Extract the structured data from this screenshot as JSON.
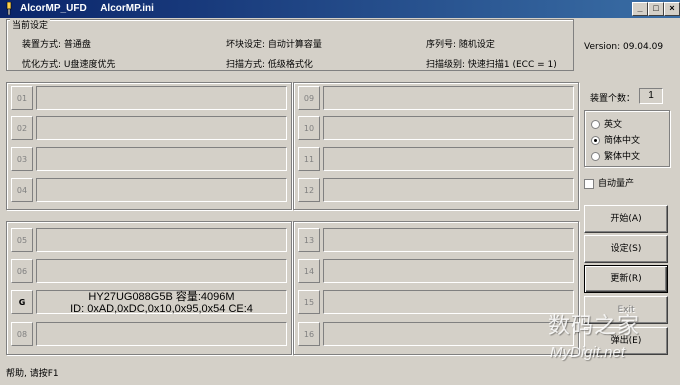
{
  "window": {
    "title": "AlcorMP_UFD     AlcorMP.ini",
    "controls": {
      "minimize": "_",
      "maximize": "□",
      "close": "×"
    }
  },
  "settings": {
    "legend": "当前设定",
    "install_mode": "装置方式: 普通盘",
    "bad_block": "坏块设定: 自动计算容量",
    "serial": "序列号: 随机设定",
    "optimize": "忧化方式: U盘速度优先",
    "scan_mode": "扫描方式: 低级格式化",
    "scan_level": "扫描级别: 快速扫描1 (ECC = 1)"
  },
  "version": "Version: 09.04.09",
  "slots_left_top": [
    "01",
    "02",
    "03",
    "04"
  ],
  "slots_right_top": [
    "09",
    "10",
    "11",
    "12"
  ],
  "slots_left_bottom": [
    "05",
    "06",
    "G",
    "08"
  ],
  "slots_right_bottom": [
    "13",
    "14",
    "15",
    "16"
  ],
  "active_slot": {
    "line1": "HY27UG088G5B 容量:4096M",
    "line2": "ID: 0xAD,0xDC,0x10,0x95,0x54  CE:4"
  },
  "device_count": {
    "label": "装置个数：",
    "value": "1"
  },
  "language": {
    "options": [
      "英文",
      "简体中文",
      "繁体中文"
    ],
    "selected": "简体中文"
  },
  "auto_production": "自动量产",
  "buttons": {
    "start": "开始(A)",
    "settings": "设定(S)",
    "refresh": "更新(R)",
    "exit_label": "Exit",
    "eject": "弹出(E)"
  },
  "status_bar": "帮助, 请按F1",
  "watermark": {
    "line1": "数码之家",
    "line2": "MyDigit.net"
  }
}
